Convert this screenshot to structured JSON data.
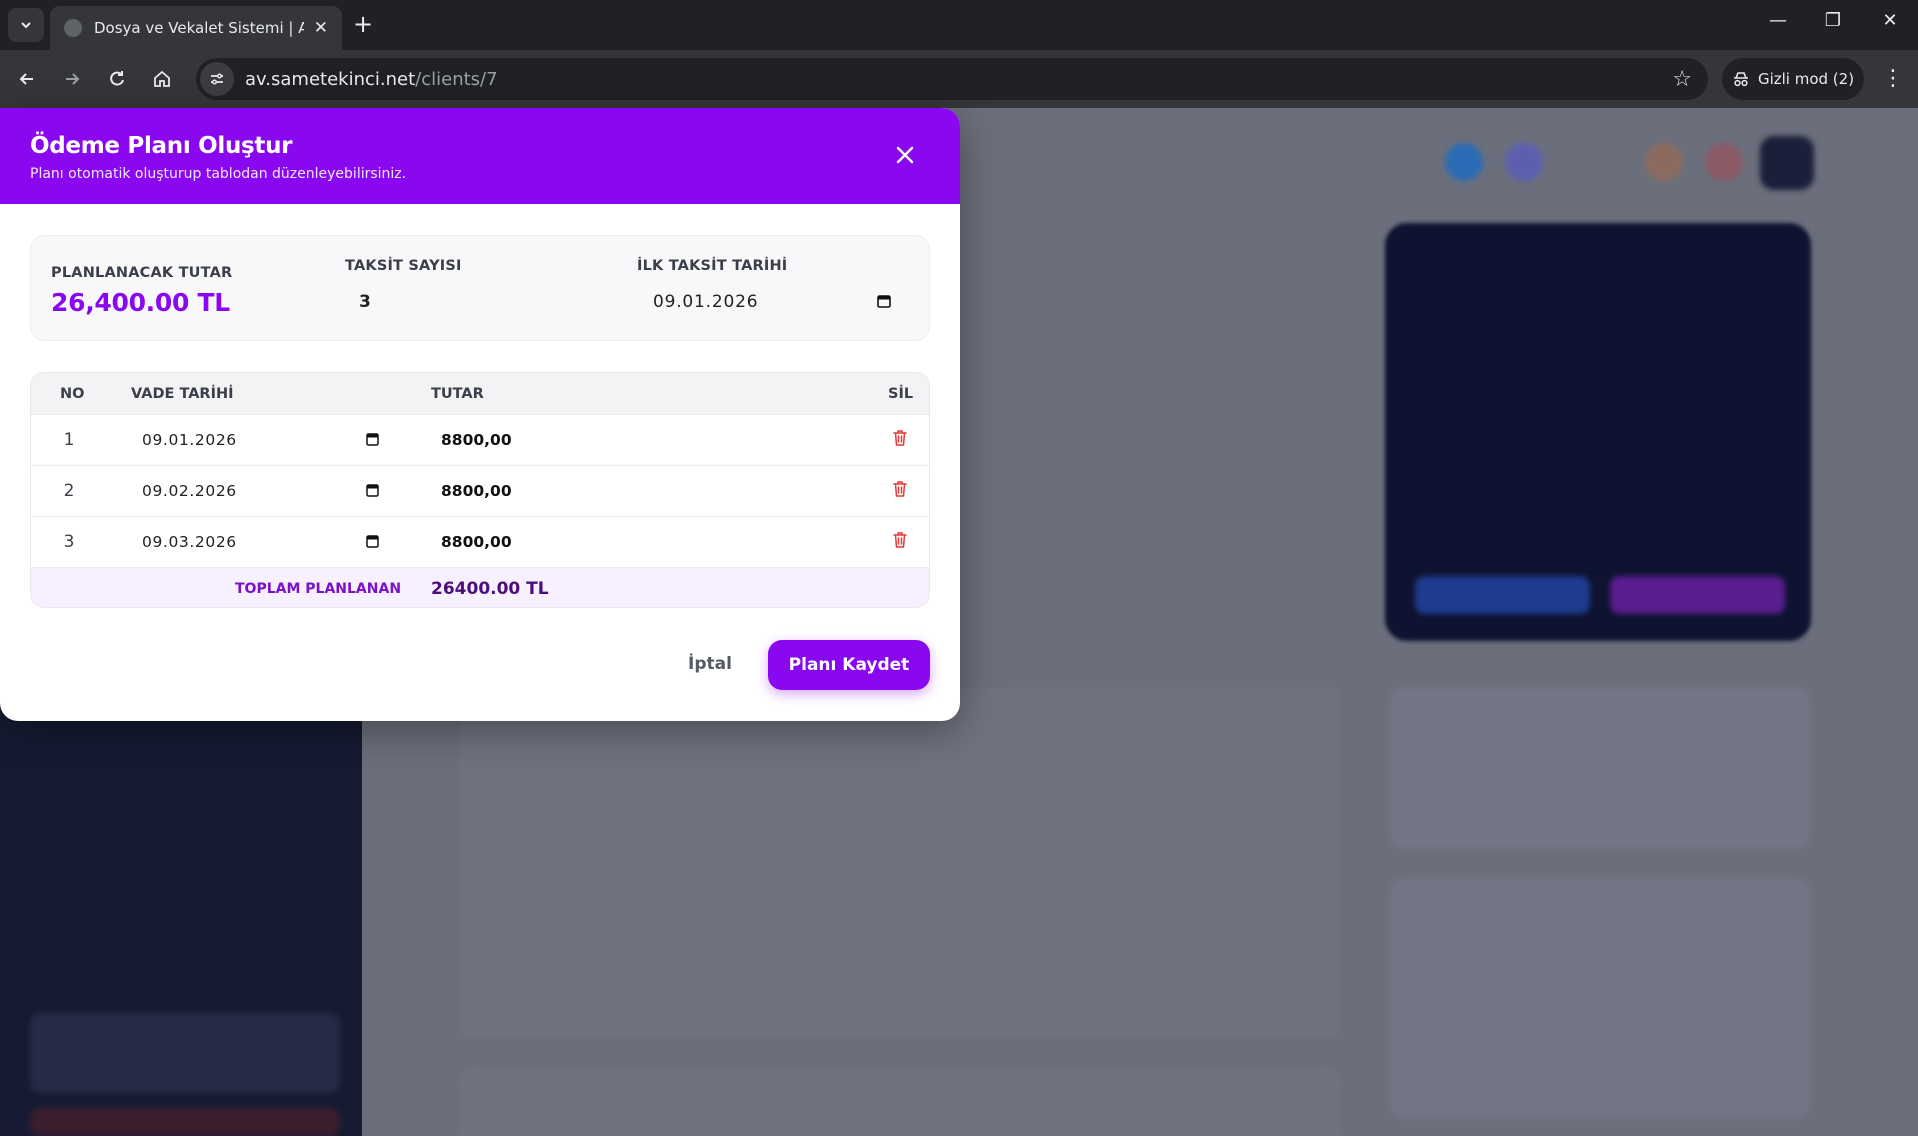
{
  "browser": {
    "tab_title": "Dosya ve Vekalet Sistemi | Avuk",
    "url_host": "av.sametekinci.net",
    "url_path": "/clients/7",
    "incognito_label": "Gizli mod (2)"
  },
  "modal": {
    "title": "Ödeme Planı Oluştur",
    "subtitle": "Planı otomatik oluşturup tablodan düzenleyebilirsiniz.",
    "summary": {
      "planned_amount_label": "PLANLANACAK TUTAR",
      "planned_amount_value": "26,400.00 TL",
      "installment_count_label": "TAKSİT SAYISI",
      "installment_count_value": "3",
      "first_date_label": "İLK TAKSİT TARİHİ",
      "first_date_value": "09.01.2026"
    },
    "table": {
      "headers": {
        "no": "NO",
        "due_date": "VADE TARİHİ",
        "amount": "TUTAR",
        "delete": "SİL"
      },
      "rows": [
        {
          "no": "1",
          "due_date": "09.01.2026",
          "amount": "8800,00"
        },
        {
          "no": "2",
          "due_date": "09.02.2026",
          "amount": "8800,00"
        },
        {
          "no": "3",
          "due_date": "09.03.2026",
          "amount": "8800,00"
        }
      ],
      "total_label": "TOPLAM PLANLANAN",
      "total_value": "26400.00 TL"
    },
    "buttons": {
      "cancel": "İptal",
      "save": "Planı Kaydet"
    }
  },
  "colors": {
    "accent": "#8a08f0",
    "delete": "#e53935"
  }
}
